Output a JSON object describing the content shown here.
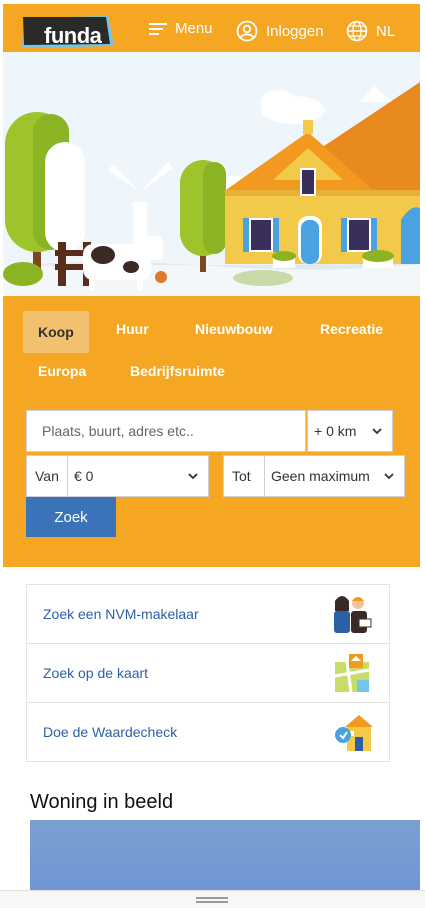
{
  "header": {
    "logo": "funda",
    "menu_label": "Menu",
    "login_label": "Inloggen",
    "language_label": "NL",
    "icons": [
      "hamburger-icon",
      "user-icon",
      "globe-icon"
    ]
  },
  "search": {
    "tabs": [
      {
        "label": "Koop",
        "active": true
      },
      {
        "label": "Huur",
        "active": false
      },
      {
        "label": "Nieuwbouw",
        "active": false
      },
      {
        "label": "Recreatie",
        "active": false
      },
      {
        "label": "Europa",
        "active": false
      },
      {
        "label": "Bedrijfsruimte",
        "active": false
      }
    ],
    "location_placeholder": "Plaats, buurt, adres etc..",
    "radius_value": "+ 0 km",
    "price_from_label": "Van",
    "price_from_value": "€ 0",
    "price_to_label": "Tot",
    "price_to_value": "Geen maximum",
    "submit_label": "Zoek"
  },
  "quick_links": [
    {
      "label": "Zoek een NVM-makelaar",
      "icon": "makelaar-icon"
    },
    {
      "label": "Zoek op de kaart",
      "icon": "map-icon"
    },
    {
      "label": "Doe de Waardecheck",
      "icon": "house-value-icon"
    }
  ],
  "section": {
    "title": "Woning in beeld"
  },
  "colors": {
    "brand_orange": "#f5a623",
    "link_blue": "#2d5fa8",
    "button_blue": "#3b73b9"
  }
}
